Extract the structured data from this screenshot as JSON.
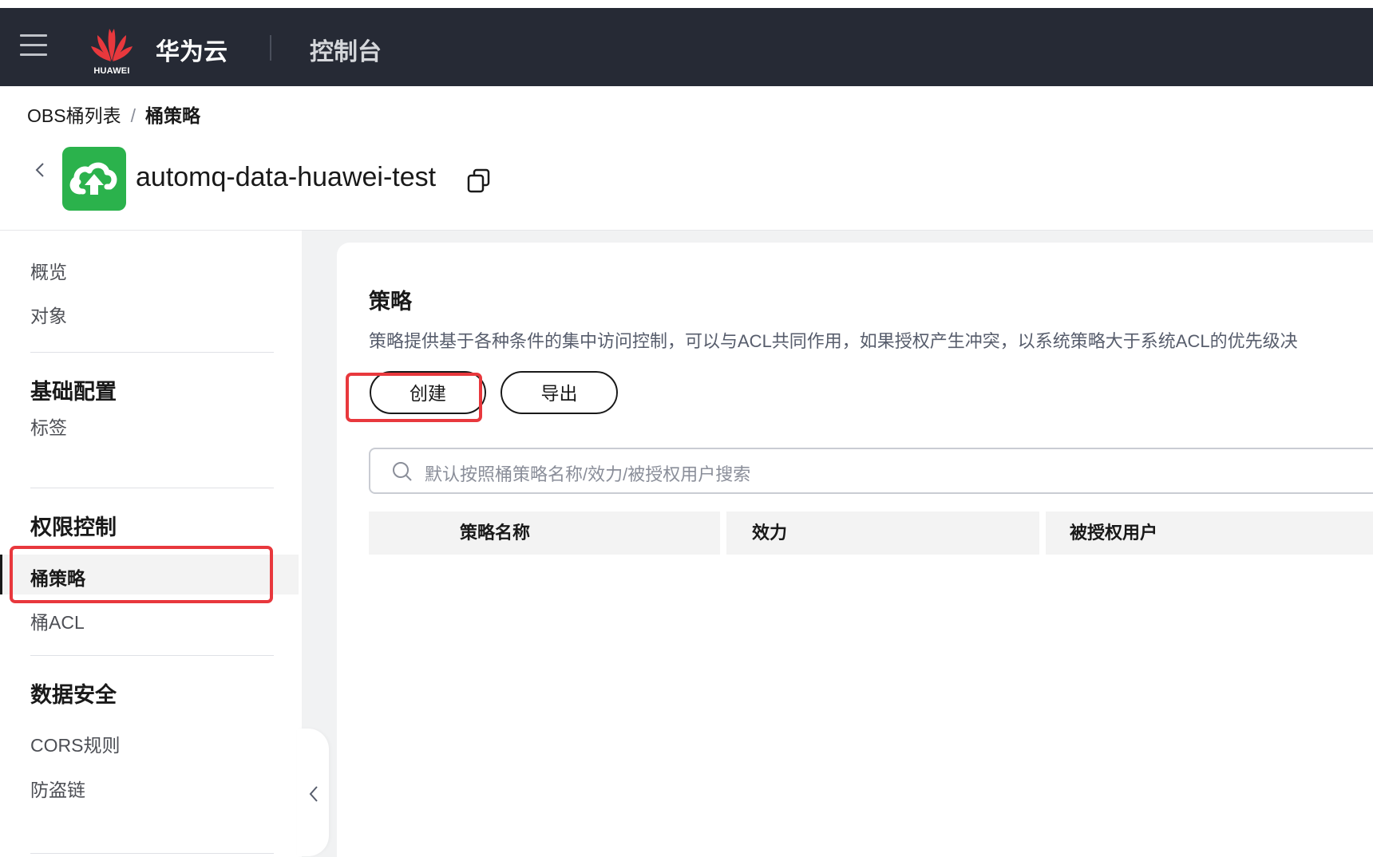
{
  "topbar": {
    "logo_text": "HUAWEI",
    "brand": "华为云",
    "console": "控制台"
  },
  "breadcrumb": {
    "parent": "OBS桶列表",
    "separator": "/",
    "current": "桶策略"
  },
  "bucket": {
    "name": "automq-data-huawei-test"
  },
  "sidebar": {
    "items_top": [
      "概览",
      "对象"
    ],
    "group1": {
      "title": "基础配置",
      "items": [
        "标签"
      ]
    },
    "group2": {
      "title": "权限控制",
      "items": [
        "桶策略",
        "桶ACL"
      ],
      "active": "桶策略"
    },
    "group3": {
      "title": "数据安全",
      "items": [
        "CORS规则",
        "防盗链"
      ]
    }
  },
  "main": {
    "title": "策略",
    "description": "策略提供基于各种条件的集中访问控制，可以与ACL共同作用，如果授权产生冲突，以系统策略大于系统ACL的优先级决",
    "create_label": "创建",
    "export_label": "导出",
    "search_placeholder": "默认按照桶策略名称/效力/被授权用户搜索",
    "table_headers": [
      "策略名称",
      "效力",
      "被授权用户"
    ]
  },
  "colors": {
    "topbar": "#262a35",
    "highlight": "#e8383d",
    "bucket_icon": "#2bb24c"
  }
}
